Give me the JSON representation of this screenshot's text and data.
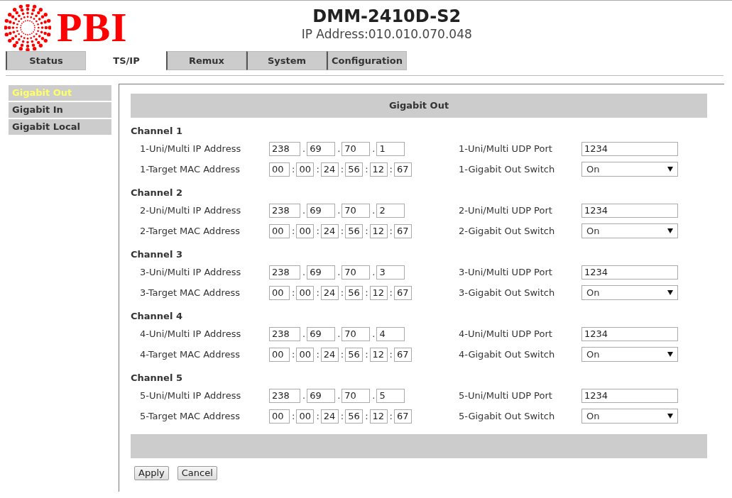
{
  "header": {
    "logo": "PBI",
    "title": "DMM-2410D-S2",
    "ip_address": "IP Address:010.010.070.048"
  },
  "tabs": [
    {
      "label": "Status",
      "selected": false
    },
    {
      "label": "TS/IP",
      "selected": true
    },
    {
      "label": "Remux",
      "selected": false
    },
    {
      "label": "System",
      "selected": false
    },
    {
      "label": "Configuration",
      "selected": false
    }
  ],
  "sidebar": {
    "items": [
      {
        "label": "Gigabit Out",
        "selected": true
      },
      {
        "label": "Gigabit In",
        "selected": false
      },
      {
        "label": "Gigabit Local",
        "selected": false
      }
    ]
  },
  "panel": {
    "title": "Gigabit Out",
    "channels": [
      {
        "title": "Channel 1",
        "ip": {
          "label": "1-Uni/Multi IP Address",
          "parts": [
            {
              "value": "238"
            },
            {
              "sep": ".",
              "value": "69"
            },
            {
              "sep": ".",
              "value": "70"
            },
            {
              "sep": ".",
              "value": "1"
            }
          ]
        },
        "mac": {
          "label": "1-Target MAC Address",
          "parts": [
            {
              "value": "00"
            },
            {
              "sep": ":",
              "value": "00"
            },
            {
              "sep": ":",
              "value": "24"
            },
            {
              "sep": ":",
              "value": "56"
            },
            {
              "sep": ":",
              "value": "12"
            },
            {
              "sep": ":",
              "value": "67"
            }
          ]
        },
        "port": {
          "label": "1-Uni/Multi UDP Port",
          "value": "1234"
        },
        "switch": {
          "label": "1-Gigabit Out Switch",
          "value": "On"
        }
      },
      {
        "title": "Channel 2",
        "ip": {
          "label": "2-Uni/Multi IP Address",
          "parts": [
            {
              "value": "238"
            },
            {
              "sep": ".",
              "value": "69"
            },
            {
              "sep": ".",
              "value": "70"
            },
            {
              "sep": ".",
              "value": "2"
            }
          ]
        },
        "mac": {
          "label": "2-Target MAC Address",
          "parts": [
            {
              "value": "00"
            },
            {
              "sep": ":",
              "value": "00"
            },
            {
              "sep": ":",
              "value": "24"
            },
            {
              "sep": ":",
              "value": "56"
            },
            {
              "sep": ":",
              "value": "12"
            },
            {
              "sep": ":",
              "value": "67"
            }
          ]
        },
        "port": {
          "label": "2-Uni/Multi UDP Port",
          "value": "1234"
        },
        "switch": {
          "label": "2-Gigabit Out Switch",
          "value": "On"
        }
      },
      {
        "title": "Channel 3",
        "ip": {
          "label": "3-Uni/Multi IP Address",
          "parts": [
            {
              "value": "238"
            },
            {
              "sep": ".",
              "value": "69"
            },
            {
              "sep": ".",
              "value": "70"
            },
            {
              "sep": ".",
              "value": "3"
            }
          ]
        },
        "mac": {
          "label": "3-Target MAC Address",
          "parts": [
            {
              "value": "00"
            },
            {
              "sep": ":",
              "value": "00"
            },
            {
              "sep": ":",
              "value": "24"
            },
            {
              "sep": ":",
              "value": "56"
            },
            {
              "sep": ":",
              "value": "12"
            },
            {
              "sep": ":",
              "value": "67"
            }
          ]
        },
        "port": {
          "label": "3-Uni/Multi UDP Port",
          "value": "1234"
        },
        "switch": {
          "label": "3-Gigabit Out Switch",
          "value": "On"
        }
      },
      {
        "title": "Channel 4",
        "ip": {
          "label": "4-Uni/Multi IP Address",
          "parts": [
            {
              "value": "238"
            },
            {
              "sep": ".",
              "value": "69"
            },
            {
              "sep": ".",
              "value": "70"
            },
            {
              "sep": ".",
              "value": "4"
            }
          ]
        },
        "mac": {
          "label": "4-Target MAC Address",
          "parts": [
            {
              "value": "00"
            },
            {
              "sep": ":",
              "value": "00"
            },
            {
              "sep": ":",
              "value": "24"
            },
            {
              "sep": ":",
              "value": "56"
            },
            {
              "sep": ":",
              "value": "12"
            },
            {
              "sep": ":",
              "value": "67"
            }
          ]
        },
        "port": {
          "label": "4-Uni/Multi UDP Port",
          "value": "1234"
        },
        "switch": {
          "label": "4-Gigabit Out Switch",
          "value": "On"
        }
      },
      {
        "title": "Channel 5",
        "ip": {
          "label": "5-Uni/Multi IP Address",
          "parts": [
            {
              "value": "238"
            },
            {
              "sep": ".",
              "value": "69"
            },
            {
              "sep": ".",
              "value": "70"
            },
            {
              "sep": ".",
              "value": "5"
            }
          ]
        },
        "mac": {
          "label": "5-Target MAC Address",
          "parts": [
            {
              "value": "00"
            },
            {
              "sep": ":",
              "value": "00"
            },
            {
              "sep": ":",
              "value": "24"
            },
            {
              "sep": ":",
              "value": "56"
            },
            {
              "sep": ":",
              "value": "12"
            },
            {
              "sep": ":",
              "value": "67"
            }
          ]
        },
        "port": {
          "label": "5-Uni/Multi UDP Port",
          "value": "1234"
        },
        "switch": {
          "label": "5-Gigabit Out Switch",
          "value": "On"
        }
      }
    ],
    "buttons": [
      "Apply",
      "Cancel"
    ]
  }
}
